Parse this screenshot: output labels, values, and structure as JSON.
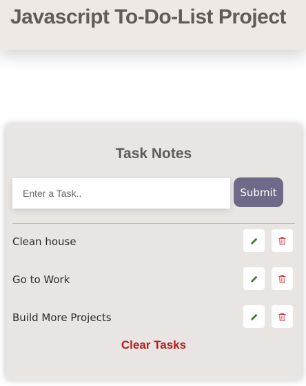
{
  "header": {
    "title": "Javascript To-Do-List Project"
  },
  "card": {
    "title": "Task Notes",
    "input": {
      "placeholder": "Enter a Task..",
      "value": ""
    },
    "submit_label": "Submit",
    "tasks": [
      {
        "label": "Clean house"
      },
      {
        "label": "Go to Work"
      },
      {
        "label": "Build More Projects"
      }
    ],
    "clear_label": "Clear Tasks"
  },
  "icons": {
    "edit": "pencil-icon",
    "delete": "trash-icon"
  },
  "colors": {
    "header_bg": "#efe9e6",
    "card_bg": "#e8e5e3",
    "submit_bg": "#6e6a87",
    "edit_icon": "#3d7a3a",
    "delete_icon": "#d0424a",
    "clear_text": "#b3201f"
  }
}
